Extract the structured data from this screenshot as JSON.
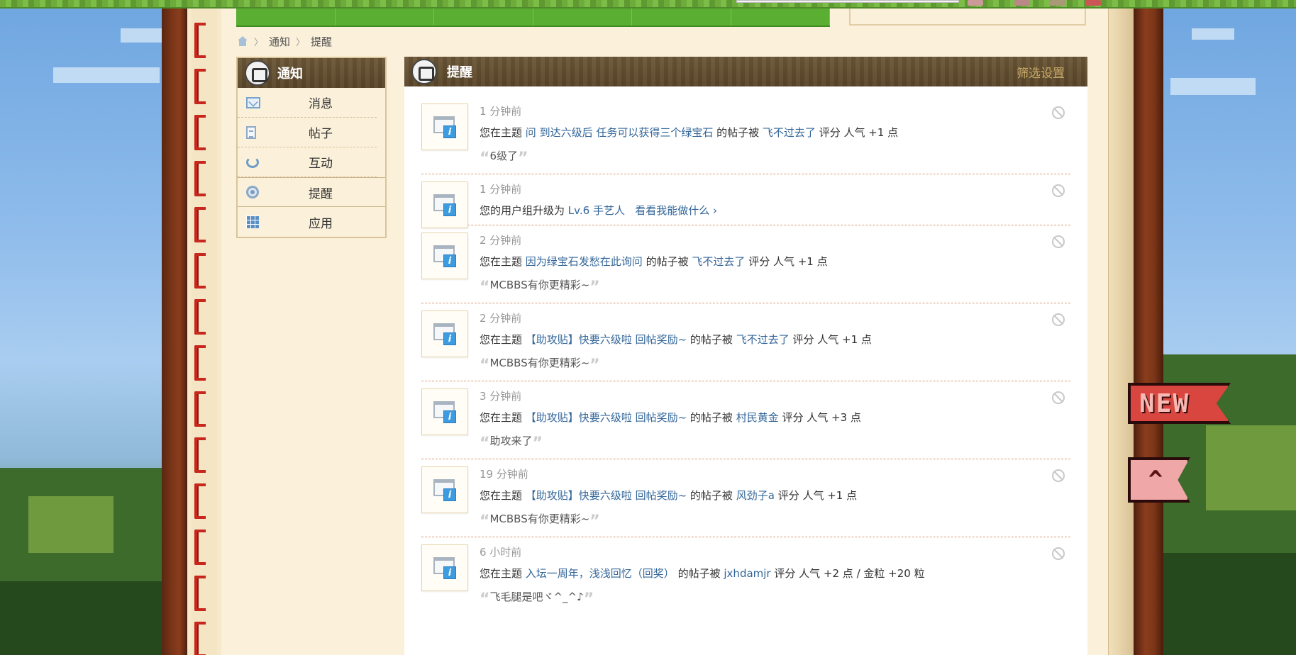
{
  "breadcrumb": {
    "items": [
      "通知",
      "提醒"
    ]
  },
  "sidebar": {
    "title": "通知",
    "items": [
      {
        "label": "消息",
        "icon": "mail-icon"
      },
      {
        "label": "帖子",
        "icon": "document-icon"
      },
      {
        "label": "互动",
        "icon": "recycle-icon"
      },
      {
        "label": "提醒",
        "icon": "bell-icon",
        "active": true
      },
      {
        "label": "应用",
        "icon": "grid-icon"
      }
    ]
  },
  "main": {
    "title": "提醒",
    "filter_label": "筛选设置"
  },
  "notices": [
    {
      "time": "1 分钟前",
      "pre": "您在主题",
      "topic": "问 到达六级后 任务可以获得三个绿宝石",
      "mid": "的帖子被",
      "user": "飞不过去了",
      "post": "评分 人气 +1 点",
      "quote": "6级了"
    },
    {
      "time": "1 分钟前",
      "pre": "您的用户组升级为",
      "topic": "Lv.6 手艺人",
      "mid": "",
      "user": "看看我能做什么 ›",
      "post": "",
      "quote": ""
    },
    {
      "time": "2 分钟前",
      "pre": "您在主题",
      "topic": "因为绿宝石发愁在此询问",
      "mid": "的帖子被",
      "user": "飞不过去了",
      "post": "评分 人气 +1 点",
      "quote": "MCBBS有你更精彩~"
    },
    {
      "time": "2 分钟前",
      "pre": "您在主题",
      "topic": "【助攻贴】快要六级啦 回帖奖励~",
      "mid": "的帖子被",
      "user": "飞不过去了",
      "post": "评分 人气 +1 点",
      "quote": "MCBBS有你更精彩~"
    },
    {
      "time": "3 分钟前",
      "pre": "您在主题",
      "topic": "【助攻贴】快要六级啦 回帖奖励~",
      "mid": "的帖子被",
      "user": "村民黄金",
      "post": "评分 人气 +3 点",
      "quote": "助攻来了"
    },
    {
      "time": "19 分钟前",
      "pre": "您在主题",
      "topic": "【助攻贴】快要六级啦 回帖奖励~",
      "mid": "的帖子被",
      "user": "风劲子a",
      "post": "评分 人气 +1 点",
      "quote": "MCBBS有你更精彩~"
    },
    {
      "time": "6 小时前",
      "pre": "您在主题",
      "topic": "入坛一周年，浅浅回忆（回奖）",
      "mid": "的帖子被",
      "user": "jxhdamjr",
      "post": "评分 人气 +2 点 / 金粒 +20 粒",
      "quote": "飞毛腿是吧ヾ^_^♪"
    }
  ],
  "flags": {
    "new_label": "NEW",
    "top_label": "^"
  },
  "colors": {
    "link": "#336699",
    "header_brown": "#5a4629",
    "paper": "#fbf1da"
  }
}
